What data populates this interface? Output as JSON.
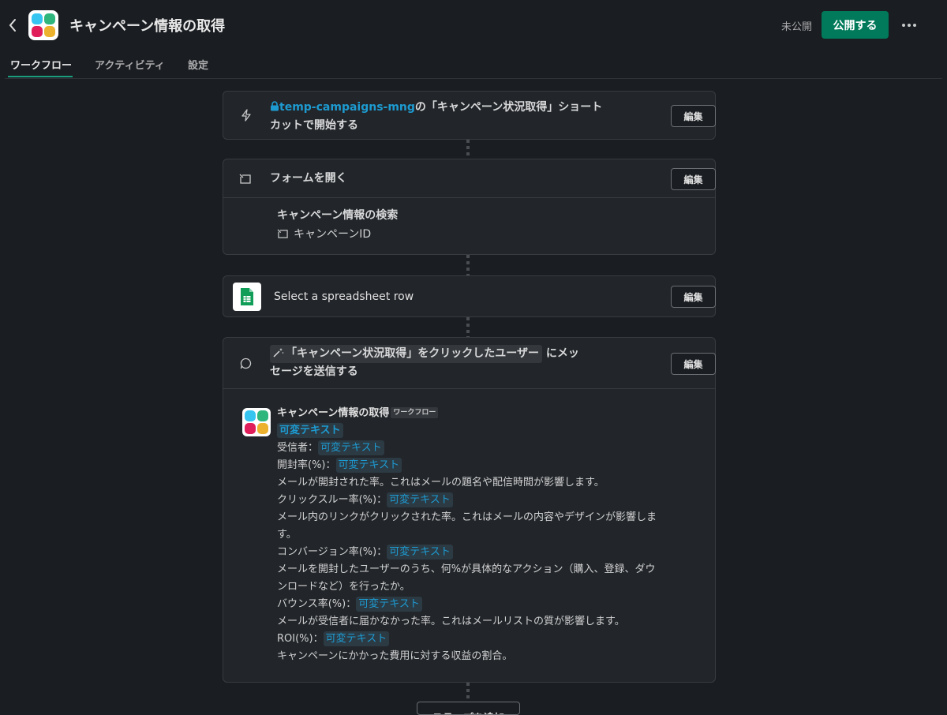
{
  "header": {
    "title": "キャンペーン情報の取得",
    "status": "未公開",
    "publish_label": "公開する"
  },
  "tabs": [
    {
      "label": "ワークフロー",
      "active": true
    },
    {
      "label": "アクティビティ",
      "active": false
    },
    {
      "label": "設定",
      "active": false
    }
  ],
  "steps": {
    "trigger": {
      "channel": "temp-campaigns-mng",
      "text_after": "の「キャンペーン状況取得」ショート",
      "text_line2": "カットで開始する",
      "edit_label": "編集"
    },
    "form": {
      "title": "フォームを開く",
      "edit_label": "編集",
      "form_name": "キャンペーン情報の検索",
      "field": "キャンペーンID"
    },
    "sheet": {
      "title": "Select a spreadsheet row",
      "edit_label": "編集"
    },
    "message": {
      "pill_text": "「キャンペーン状況取得」をクリックしたユーザー",
      "title_after": "にメッ",
      "title_line2": "セージを送信する",
      "edit_label": "編集",
      "sender": "キャンペーン情報の取得",
      "sender_tag": "ワークフロー",
      "variable": "可変テキスト",
      "lines": {
        "recipient": "受信者：",
        "open_rate": "開封率(%)：",
        "open_desc": "メールが開封された率。これはメールの題名や配信時間が影響します。",
        "ctr": "クリックスルー率(%)：",
        "ctr_desc1": "メール内のリンクがクリックされた率。これはメールの内容やデザインが影響しま",
        "ctr_desc2": "す。",
        "cv": "コンバージョン率(%)：",
        "cv_desc1": "メールを開封したユーザーのうち、何%が具体的なアクション（購入、登録、ダウ",
        "cv_desc2": "ンロードなど）を行ったか。",
        "bounce": "バウンス率(%)：",
        "bounce_desc": "メールが受信者に届かなかった率。これはメールリストの質が影響します。",
        "roi": "ROI(%)：",
        "roi_desc": "キャンペーンにかかった費用に対する収益の割合。"
      }
    }
  },
  "add_step_label": "ステップを追加",
  "colors": {
    "background": "#1a1d21",
    "card": "#222529",
    "accent_green": "#007a5a",
    "link_blue": "#1d9bd1"
  }
}
